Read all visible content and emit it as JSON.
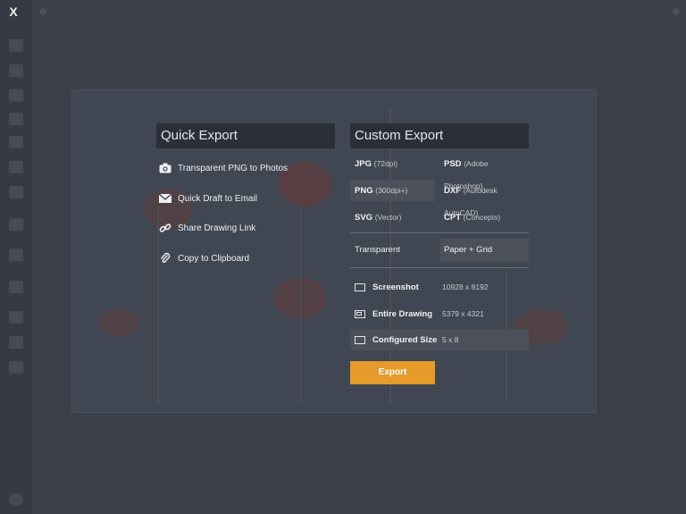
{
  "close_label": "X",
  "quick_export": {
    "title": "Quick Export",
    "items": [
      {
        "label": "Transparent PNG to Photos",
        "icon": "camera-icon"
      },
      {
        "label": "Quick Draft to Email",
        "icon": "envelope-icon"
      },
      {
        "label": "Share Drawing Link",
        "icon": "link-icon"
      },
      {
        "label": "Copy to Clipboard",
        "icon": "paperclip-icon"
      }
    ]
  },
  "custom_export": {
    "title": "Custom Export",
    "formats": [
      {
        "name": "JPG",
        "detail": "(72dpi)",
        "selected": false
      },
      {
        "name": "PSD",
        "detail": "(Adobe Photoshop)",
        "selected": false
      },
      {
        "name": "PNG",
        "detail": "(300dpi+)",
        "selected": true
      },
      {
        "name": "DXF",
        "detail": "(Autodesk AutoCAD)",
        "selected": false
      },
      {
        "name": "SVG",
        "detail": "(Vector)",
        "selected": false
      },
      {
        "name": "CPT",
        "detail": "(Concepts)",
        "selected": false
      }
    ],
    "backgrounds": [
      {
        "label": "Transparent",
        "selected": false
      },
      {
        "label": "Paper + Grid",
        "selected": true
      }
    ],
    "sizes": [
      {
        "label": "Screenshot",
        "value": "10928 x 8192",
        "icon": "screenshot-icon",
        "selected": false
      },
      {
        "label": "Entire Drawing",
        "value": "5379 x 4321",
        "icon": "entire-drawing-icon",
        "selected": false
      },
      {
        "label": "Configured Size",
        "value": "5 x 8",
        "icon": "configured-size-icon",
        "selected": true
      }
    ],
    "export_label": "Export"
  },
  "colors": {
    "accent": "#e49b2a",
    "panel_header": "#2b2f37",
    "selected_row": "#4b505b",
    "background": "#3a3f4a"
  }
}
